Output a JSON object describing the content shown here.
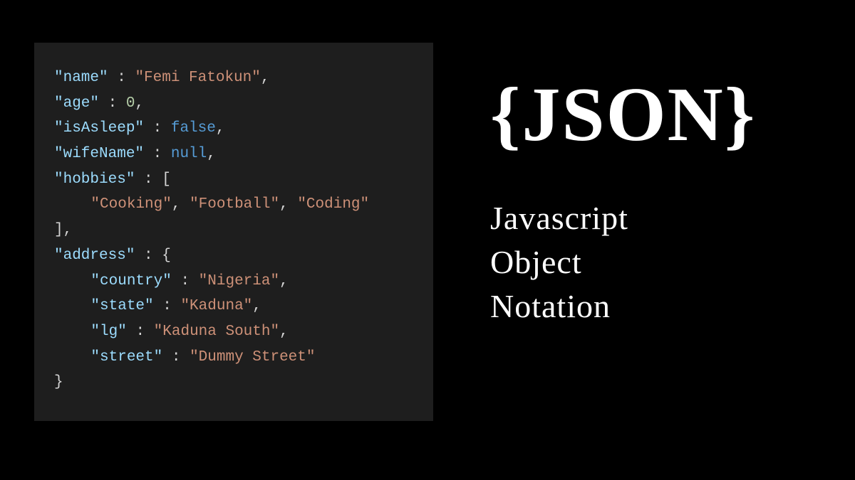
{
  "code": {
    "key_name": "\"name\"",
    "val_name": "\"Femi Fatokun\"",
    "key_age": "\"age\"",
    "val_age": "0",
    "key_isAsleep": "\"isAsleep\"",
    "val_isAsleep": "false",
    "key_wifeName": "\"wifeName\"",
    "val_wifeName": "null",
    "key_hobbies": "\"hobbies\"",
    "hobby1": "\"Cooking\"",
    "hobby2": "\"Football\"",
    "hobby3": "\"Coding\"",
    "key_address": "\"address\"",
    "key_country": "\"country\"",
    "val_country": "\"Nigeria\"",
    "key_state": "\"state\"",
    "val_state": "\"Kaduna\"",
    "key_lg": "\"lg\"",
    "val_lg": "\"Kaduna South\"",
    "key_street": "\"street\"",
    "val_street": "\"Dummy Street\""
  },
  "title": {
    "heading": "{JSON}",
    "line1": "Javascript",
    "line2": "Object",
    "line3": "Notation"
  }
}
